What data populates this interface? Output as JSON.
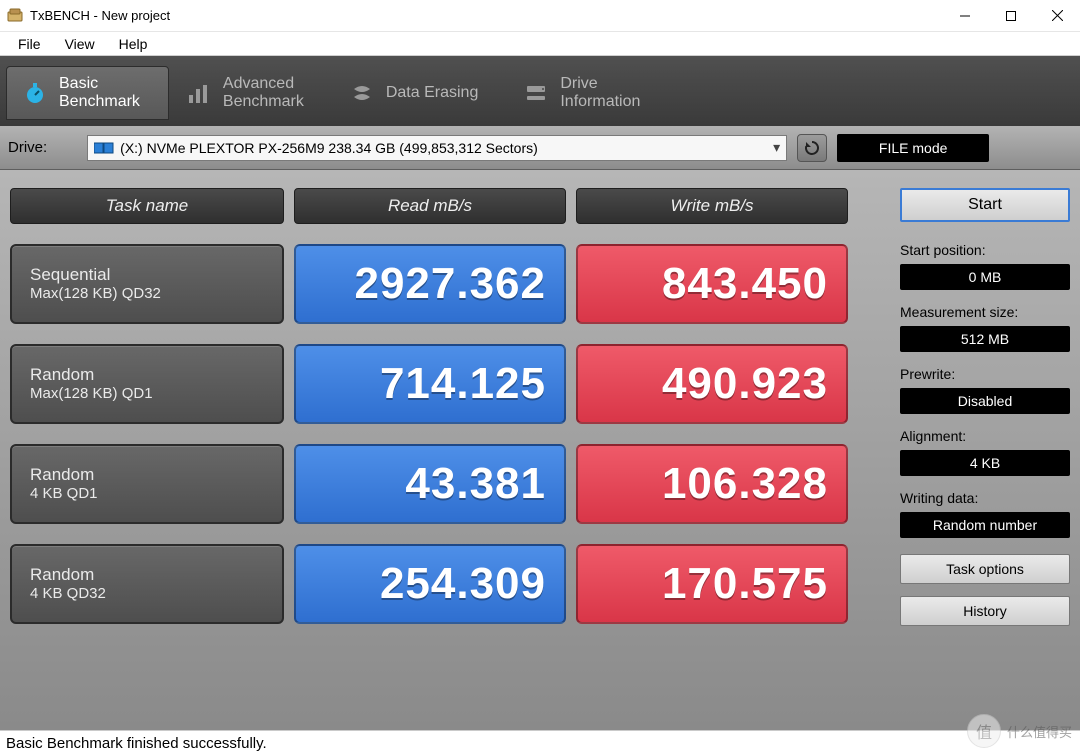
{
  "window": {
    "title": "TxBENCH - New project"
  },
  "menus": {
    "file": "File",
    "view": "View",
    "help": "Help"
  },
  "tabs": {
    "basic": {
      "l1": "Basic",
      "l2": "Benchmark"
    },
    "advanced": {
      "l1": "Advanced",
      "l2": "Benchmark"
    },
    "erasing": {
      "label": "Data Erasing"
    },
    "drive": {
      "l1": "Drive",
      "l2": "Information"
    }
  },
  "drivebar": {
    "label": "Drive:",
    "selected": "(X:) NVMe PLEXTOR PX-256M9  238.34 GB (499,853,312 Sectors)",
    "filemode": "FILE mode"
  },
  "headers": {
    "task": "Task name",
    "read": "Read mB/s",
    "write": "Write mB/s"
  },
  "rows": [
    {
      "task_l1": "Sequential",
      "task_l2": "Max(128 KB) QD32",
      "read": "2927.362",
      "write": "843.450"
    },
    {
      "task_l1": "Random",
      "task_l2": "Max(128 KB) QD1",
      "read": "714.125",
      "write": "490.923"
    },
    {
      "task_l1": "Random",
      "task_l2": "4 KB QD1",
      "read": "43.381",
      "write": "106.328"
    },
    {
      "task_l1": "Random",
      "task_l2": "4 KB QD32",
      "read": "254.309",
      "write": "170.575"
    }
  ],
  "side": {
    "start": "Start",
    "startpos_label": "Start position:",
    "startpos_val": "0 MB",
    "msize_label": "Measurement size:",
    "msize_val": "512 MB",
    "prewrite_label": "Prewrite:",
    "prewrite_val": "Disabled",
    "align_label": "Alignment:",
    "align_val": "4 KB",
    "wdata_label": "Writing data:",
    "wdata_val": "Random number",
    "taskopts": "Task options",
    "history": "History"
  },
  "status": "Basic Benchmark finished successfully.",
  "watermark": {
    "char": "值",
    "text": "什么值得买"
  }
}
